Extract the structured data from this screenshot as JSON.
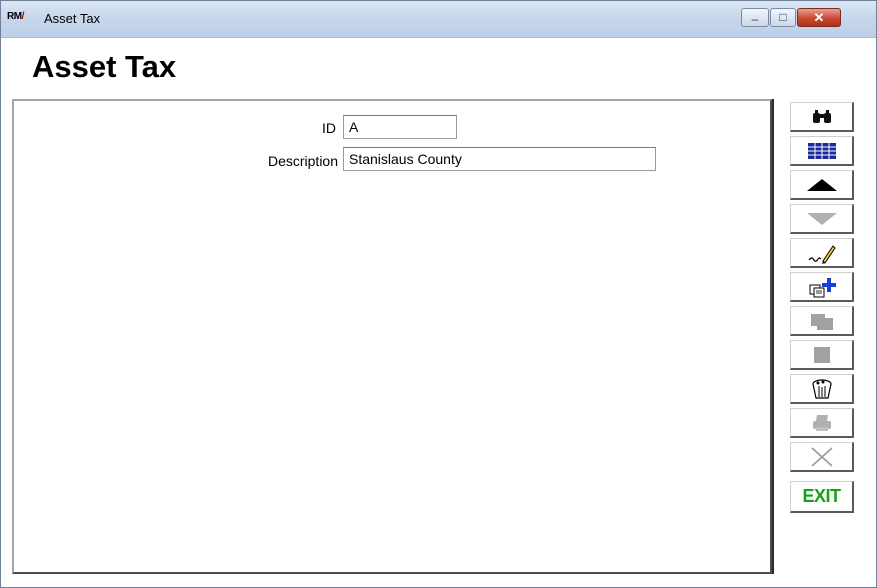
{
  "window": {
    "title": "Asset Tax",
    "app_icon_text": "RM",
    "app_icon_slash": "/",
    "buttons": {
      "minimize": "–",
      "maximize": "□",
      "close": "✕"
    }
  },
  "page": {
    "title": "Asset Tax"
  },
  "form": {
    "id": {
      "label": "ID",
      "value": "A"
    },
    "description": {
      "label": "Description",
      "value": "Stanislaus County"
    }
  },
  "toolbar": {
    "exit_label": "EXIT",
    "items": [
      {
        "icon": "binoculars-icon",
        "enabled": true
      },
      {
        "icon": "table-grid-icon",
        "enabled": true
      },
      {
        "icon": "arrow-up-icon",
        "enabled": true
      },
      {
        "icon": "arrow-down-icon",
        "enabled": false
      },
      {
        "icon": "edit-pen-icon",
        "enabled": true
      },
      {
        "icon": "add-record-icon",
        "enabled": true
      },
      {
        "icon": "copy-icon",
        "enabled": false
      },
      {
        "icon": "save-icon",
        "enabled": false
      },
      {
        "icon": "delete-trash-icon",
        "enabled": true
      },
      {
        "icon": "print-icon",
        "enabled": false
      },
      {
        "icon": "cancel-x-icon",
        "enabled": false
      },
      {
        "icon": "exit-icon",
        "enabled": true
      }
    ]
  },
  "colors": {
    "exit": "#18a018",
    "grid_icon": "#1a2a9c",
    "add_plus": "#1a3fd8"
  }
}
